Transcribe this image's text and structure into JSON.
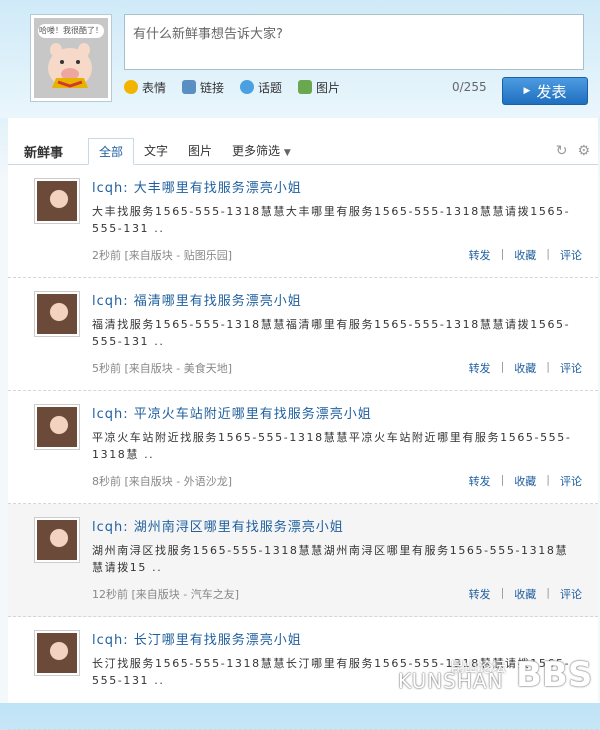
{
  "composer": {
    "avatar_bubble": "哈喽！我很酷了！",
    "placeholder": "有什么新鲜事想告诉大家?",
    "tools": [
      {
        "label": "表情",
        "icon": "emoticon-icon",
        "color": "#f2b400"
      },
      {
        "label": "链接",
        "icon": "link-icon",
        "color": "#5a8fc4"
      },
      {
        "label": "话题",
        "icon": "topic-icon",
        "color": "#4aa0e0"
      },
      {
        "label": "图片",
        "icon": "picture-icon",
        "color": "#6aa84f"
      }
    ],
    "counter": "0/255",
    "post_label": "发表"
  },
  "feed_header": {
    "title": "新鲜事",
    "tabs": [
      {
        "label": "全部",
        "active": true
      },
      {
        "label": "文字",
        "active": false
      },
      {
        "label": "图片",
        "active": false
      },
      {
        "label": "更多筛选",
        "active": false
      }
    ]
  },
  "actions": {
    "forward": "转发",
    "favorite": "收藏",
    "comment": "评论"
  },
  "feed": [
    {
      "title": "lcqh: 大丰哪里有找服务漂亮小姐",
      "body": "大丰找服务1565-555-1318慧慧大丰哪里有服务1565-555-1318慧慧请拨1565-555-131 ..",
      "meta": "2秒前 [来自版块 - 贴图乐园]"
    },
    {
      "title": "lcqh: 福清哪里有找服务漂亮小姐",
      "body": "福清找服务1565-555-1318慧慧福清哪里有服务1565-555-1318慧慧请拨1565-555-131 ..",
      "meta": "5秒前 [来自版块 - 美食天地]"
    },
    {
      "title": "lcqh: 平凉火车站附近哪里有找服务漂亮小姐",
      "body": "平凉火车站附近找服务1565-555-1318慧慧平凉火车站附近哪里有服务1565-555-1318慧 ..",
      "meta": "8秒前 [来自版块 - 外语沙龙]"
    },
    {
      "title": "lcqh: 湖州南浔区哪里有找服务漂亮小姐",
      "body": "湖州南浔区找服务1565-555-1318慧慧湖州南浔区哪里有服务1565-555-1318慧慧请拨15 ..",
      "meta": "12秒前 [来自版块 - 汽车之友]"
    },
    {
      "title": "lcqh: 长汀哪里有找服务漂亮小姐",
      "body": "长汀找服务1565-555-1318慧慧长汀哪里有服务1565-555-1318慧慧请拨1565-555-131 ..",
      "meta": ""
    }
  ],
  "watermark": {
    "main": "KUNSHAN",
    "bbs": "BBS",
    "small": "昆山论坛"
  }
}
